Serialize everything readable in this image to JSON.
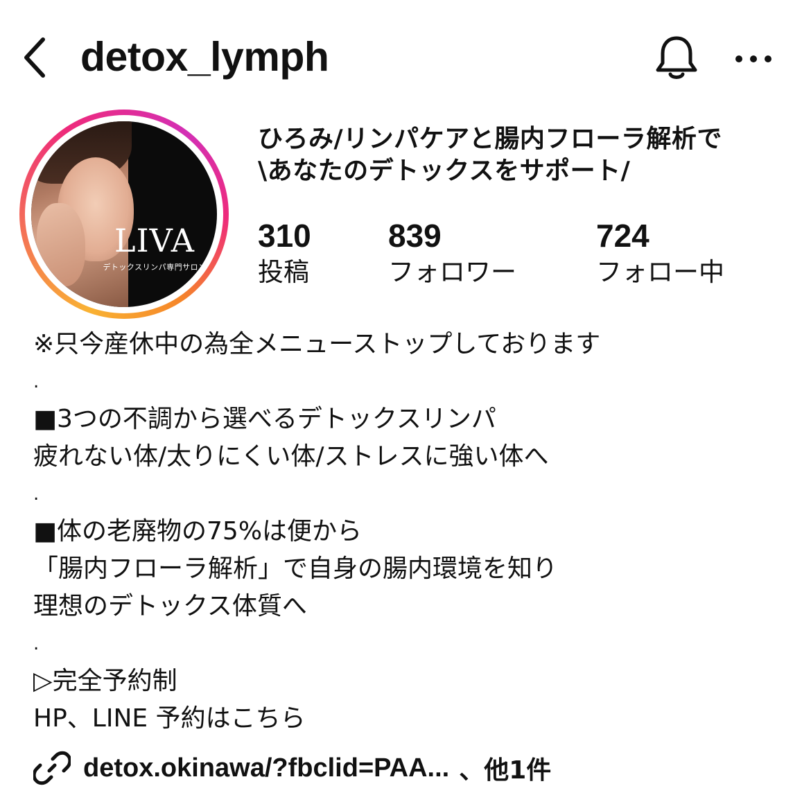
{
  "header": {
    "username": "detox_lymph",
    "back_icon": "chevron-left-icon",
    "bell_icon": "bell-icon",
    "more_icon": "ellipsis-icon"
  },
  "avatar": {
    "logo_text": "LIVA",
    "logo_subtext": "デトックスリンパ専門サロン",
    "ring_colors": [
      "#f9b233",
      "#ee2a7b",
      "#d32fb5",
      "#f58529"
    ]
  },
  "profile": {
    "name_line1": "ひろみ/リンパケアと腸内フローラ解析で",
    "name_line2": "\\あなたのデトックスをサポート/"
  },
  "stats": {
    "posts": {
      "count": "310",
      "label": "投稿"
    },
    "followers": {
      "count": "839",
      "label": "フォロワー"
    },
    "following": {
      "count": "724",
      "label": "フォロー中"
    }
  },
  "bio": {
    "line1": "※只今産休中の為全メニューストップしております",
    "dot1": ".",
    "line2": "■3つの不調から選べるデトックスリンパ",
    "line3": "疲れない体/太りにくい体/ストレスに強い体へ",
    "dot2": ".",
    "line4": "■体の老廃物の75%は便から",
    "line5": "「腸内フローラ解析」で自身の腸内環境を知り",
    "line6": "理想のデトックス体質へ",
    "dot3": ".",
    "line7": "▷完全予約制",
    "line8": "HP、LINE 予約はこちら"
  },
  "link": {
    "icon": "link-icon",
    "url_text": "detox.okinawa/?fbclid=PAA...",
    "extra_text": "、他1件"
  }
}
